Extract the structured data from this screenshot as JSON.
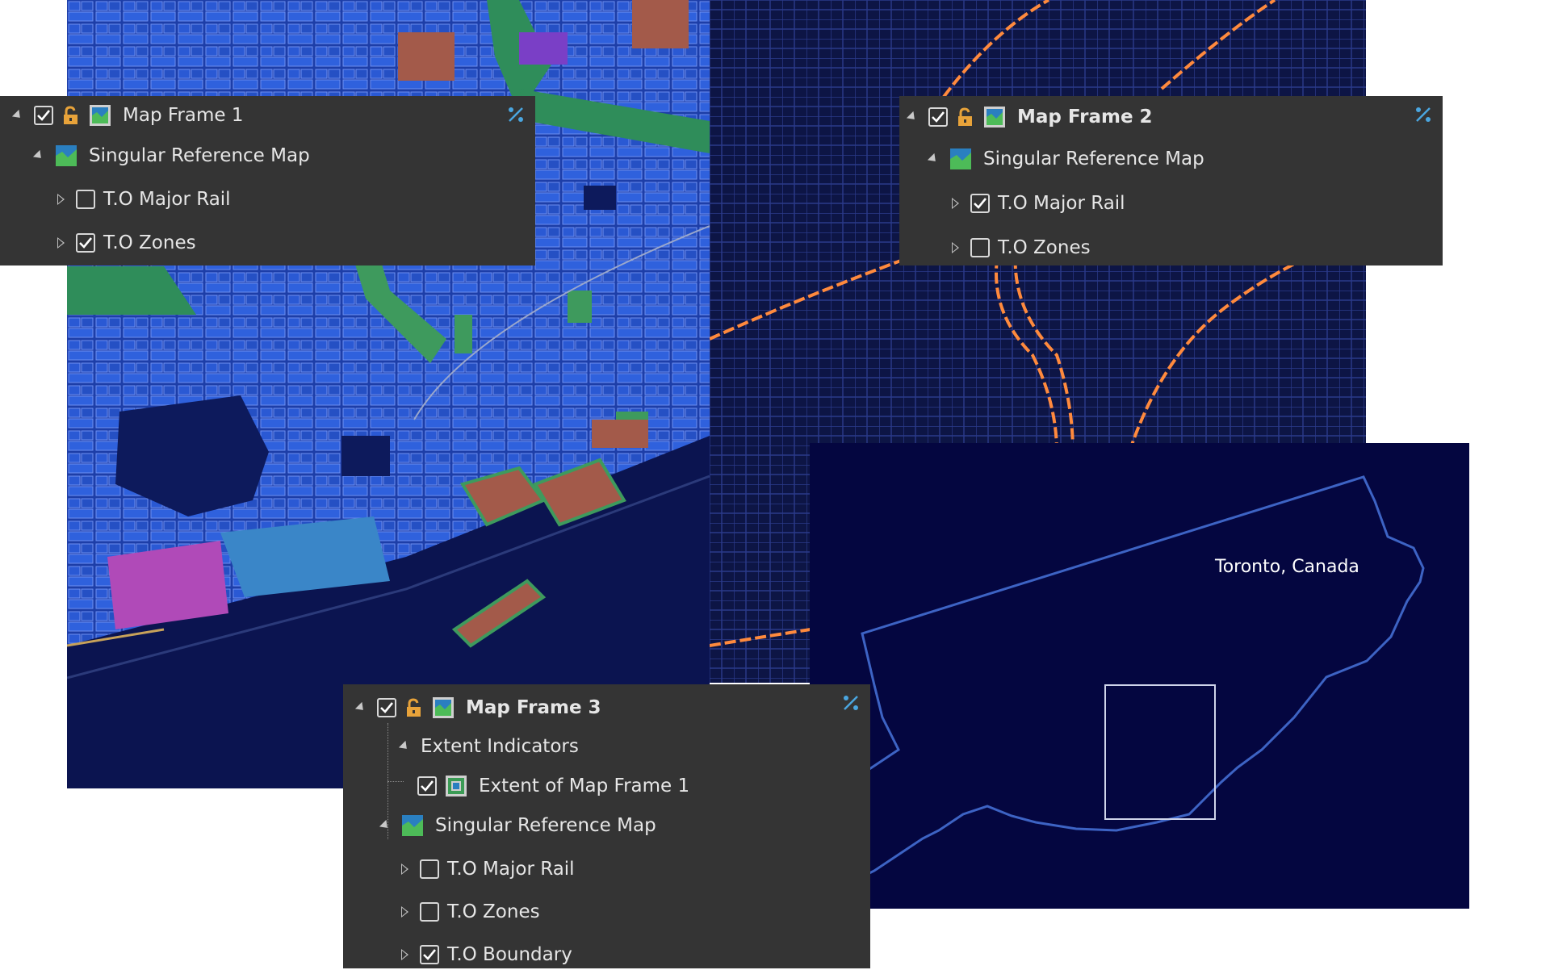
{
  "map_label": "Toronto, Canada",
  "colors": {
    "panel_bg": "#343434",
    "text": "#e6e6e6",
    "lock_orange": "#e8a33a",
    "percent_blue": "#4aa6e0",
    "map_water_dark": "#040640",
    "zones_blue": "#2a5ad6",
    "rail_orange": "#ff8a3d"
  },
  "panel1": {
    "title": "Map Frame 1",
    "group": "Singular Reference Map",
    "layers": [
      {
        "label": "T.O Major Rail",
        "checked": false
      },
      {
        "label": "T.O Zones",
        "checked": true
      }
    ]
  },
  "panel2": {
    "title": "Map Frame 2",
    "group": "Singular Reference Map",
    "layers": [
      {
        "label": "T.O Major Rail",
        "checked": true
      },
      {
        "label": "T.O Zones",
        "checked": false
      }
    ]
  },
  "panel3": {
    "title": "Map Frame 3",
    "extent_group": "Extent Indicators",
    "extent_item": "Extent of Map Frame 1",
    "group": "Singular Reference Map",
    "layers": [
      {
        "label": "T.O Major Rail",
        "checked": false
      },
      {
        "label": "T.O Zones",
        "checked": false
      },
      {
        "label": "T.O Boundary",
        "checked": true
      }
    ]
  }
}
